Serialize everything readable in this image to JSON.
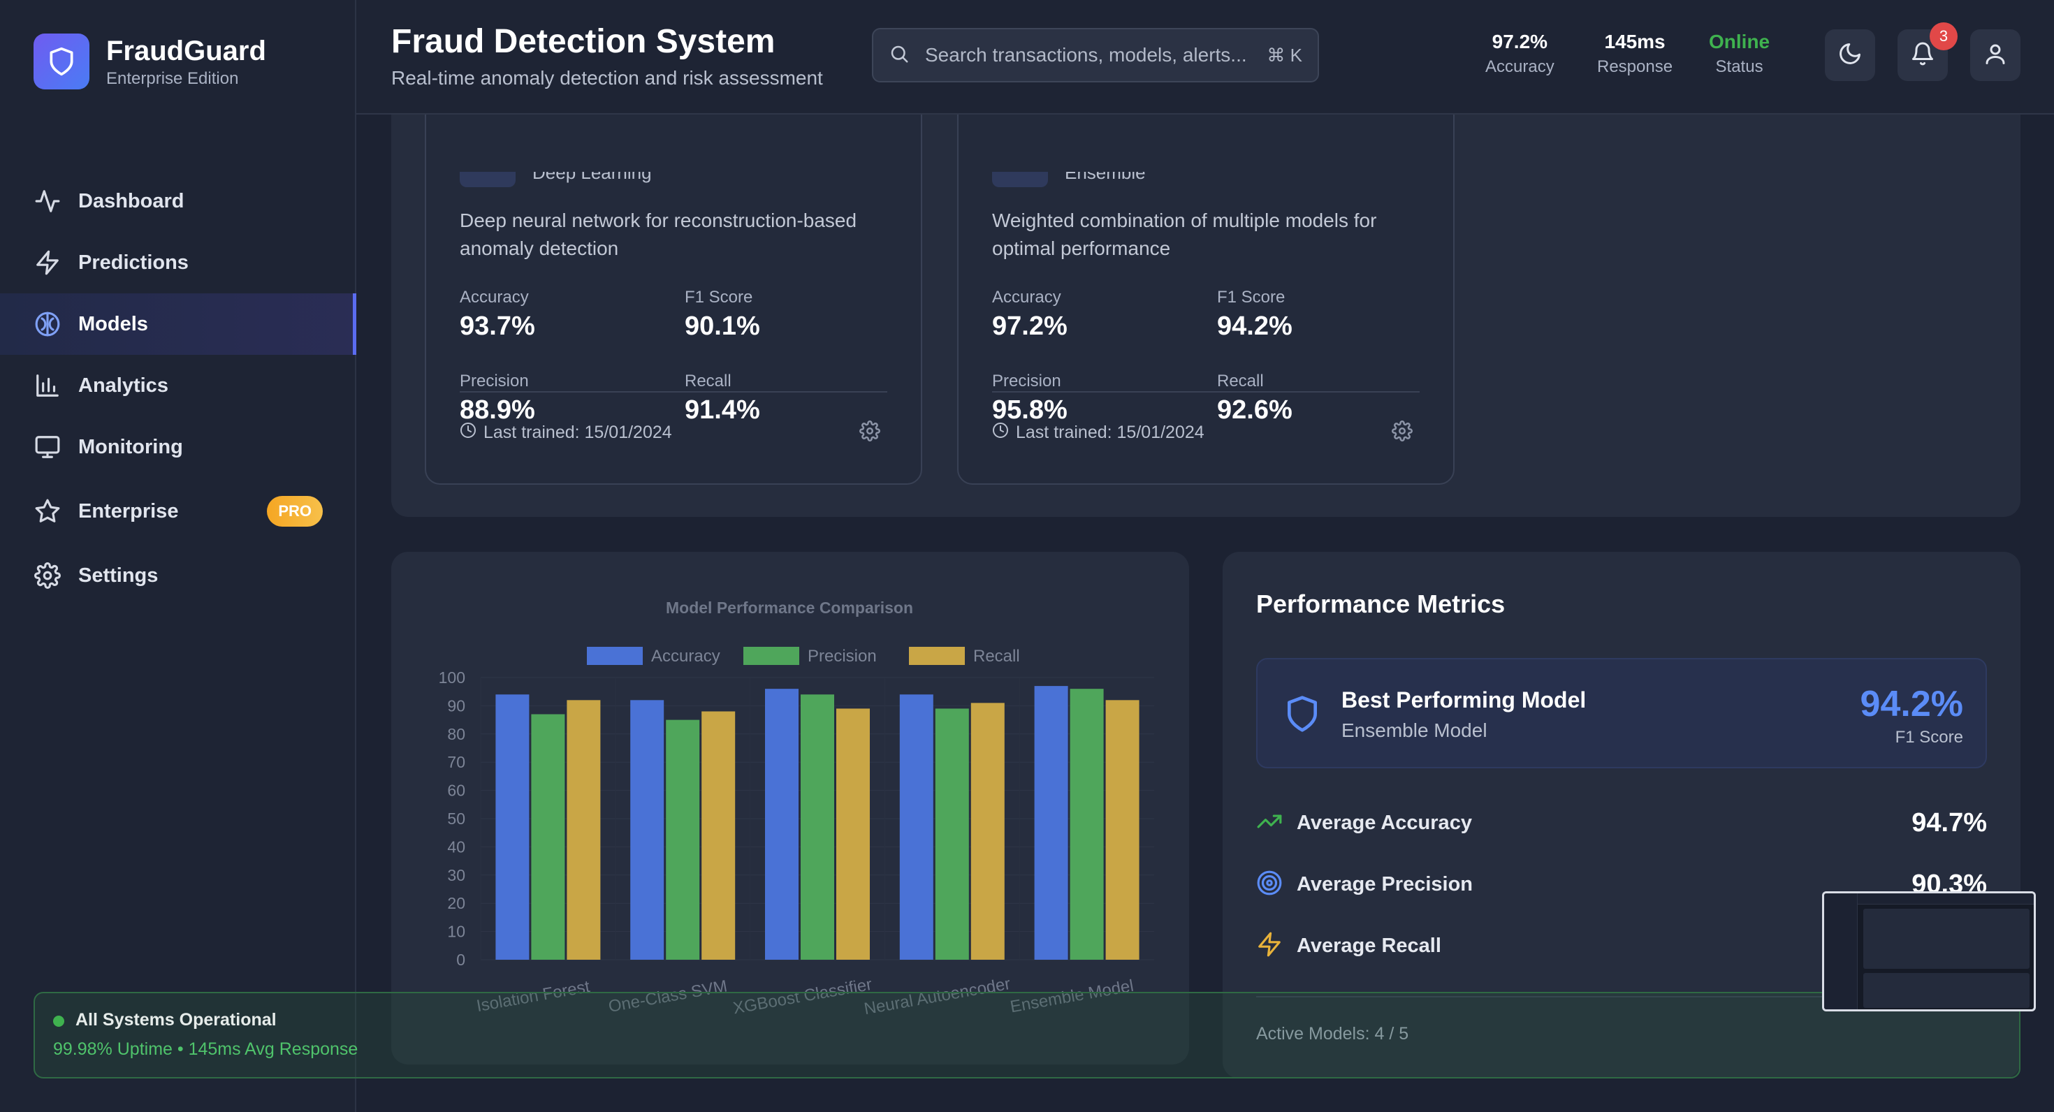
{
  "brand": {
    "name": "FraudGuard",
    "edition": "Enterprise Edition"
  },
  "nav": {
    "items": [
      {
        "label": "Dashboard",
        "icon": "activity-icon"
      },
      {
        "label": "Predictions",
        "icon": "zap-icon"
      },
      {
        "label": "Models",
        "icon": "brain-icon",
        "active": true
      },
      {
        "label": "Analytics",
        "icon": "bar-chart-icon"
      },
      {
        "label": "Monitoring",
        "icon": "monitor-icon"
      },
      {
        "label": "Enterprise",
        "icon": "star-icon",
        "badge": "PRO"
      },
      {
        "label": "Settings",
        "icon": "gear-icon"
      }
    ]
  },
  "header": {
    "title": "Fraud Detection System",
    "subtitle": "Real-time anomaly detection and risk assessment",
    "search_placeholder": "Search transactions, models, alerts...",
    "search_shortcut": "⌘ K",
    "stats": [
      {
        "value": "97.2%",
        "label": "Accuracy"
      },
      {
        "value": "145ms",
        "label": "Response"
      },
      {
        "value": "Online",
        "label": "Status"
      }
    ],
    "notification_count": "3"
  },
  "model_cards": [
    {
      "type": "Deep Learning",
      "description": "Deep neural network for reconstruction-based anomaly detection",
      "metrics": [
        {
          "label": "Accuracy",
          "value": "93.7%"
        },
        {
          "label": "F1 Score",
          "value": "90.1%"
        },
        {
          "label": "Precision",
          "value": "88.9%"
        },
        {
          "label": "Recall",
          "value": "91.4%"
        }
      ],
      "last_trained": "Last trained: 15/01/2024"
    },
    {
      "type": "Ensemble",
      "description": "Weighted combination of multiple models for optimal performance",
      "metrics": [
        {
          "label": "Accuracy",
          "value": "97.2%"
        },
        {
          "label": "F1 Score",
          "value": "94.2%"
        },
        {
          "label": "Precision",
          "value": "95.8%"
        },
        {
          "label": "Recall",
          "value": "92.6%"
        }
      ],
      "last_trained": "Last trained: 15/01/2024"
    }
  ],
  "chart_data": {
    "type": "bar",
    "title": "Model Performance Comparison",
    "categories": [
      "Isolation Forest",
      "One-Class SVM",
      "XGBoost Classifier",
      "Neural Autoencoder",
      "Ensemble Model"
    ],
    "series": [
      {
        "name": "Accuracy",
        "color": "#4a72d6",
        "values": [
          94,
          92,
          96,
          94,
          97
        ]
      },
      {
        "name": "Precision",
        "color": "#4fa65b",
        "values": [
          87,
          85,
          94,
          89,
          96
        ]
      },
      {
        "name": "Recall",
        "color": "#c9a646",
        "values": [
          92,
          88,
          89,
          91,
          92
        ]
      }
    ],
    "yticks": [
      "100",
      "90",
      "80",
      "70",
      "60",
      "50",
      "40",
      "30",
      "20",
      "10",
      "0"
    ],
    "ylim": [
      0,
      100
    ],
    "legend": "top",
    "grid": true
  },
  "performance": {
    "title": "Performance Metrics",
    "best": {
      "title": "Best Performing Model",
      "model": "Ensemble Model",
      "value": "94.2%",
      "label": "F1 Score"
    },
    "averages": [
      {
        "label": "Average Accuracy",
        "value": "94.7%",
        "icon": "trending-up-icon",
        "color": "#3fb24f"
      },
      {
        "label": "Average Precision",
        "value": "90.3%",
        "icon": "target-icon",
        "color": "#5b8cf7"
      },
      {
        "label": "Average Recall",
        "value": "",
        "icon": "zap-icon",
        "color": "#e8b23a"
      }
    ],
    "active_models": "Active Models: 4 / 5"
  },
  "status": {
    "title": "All Systems Operational",
    "detail": "99.98% Uptime • 145ms Avg Response"
  }
}
